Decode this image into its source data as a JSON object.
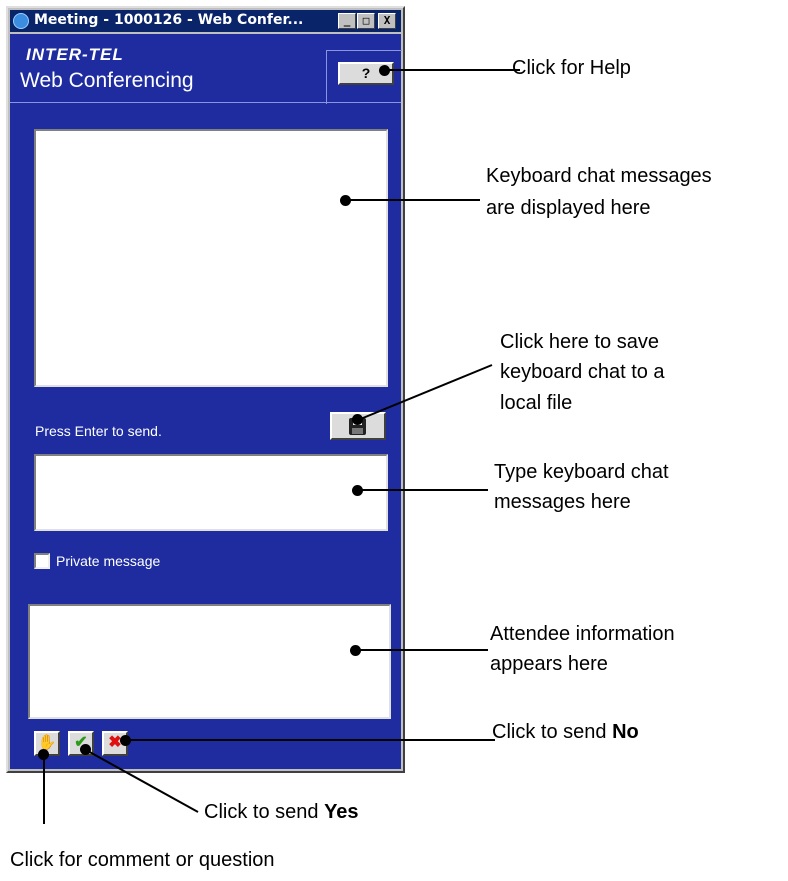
{
  "window": {
    "title": "Meeting - 1000126 - Web Confer...",
    "controls": [
      "_",
      "□",
      "X"
    ]
  },
  "header": {
    "logo": "INTER-TEL",
    "app_title": "Web Conferencing",
    "help_label": "?"
  },
  "chat": {
    "messages": "",
    "hint": "Press Enter to send.",
    "input_value": "",
    "private_label": "Private message",
    "private_checked": false
  },
  "attendee": {
    "info": ""
  },
  "buttons": {
    "hand_icon": "hand-icon",
    "yes_icon": "check-icon",
    "no_icon": "x-icon",
    "save_icon": "floppy-disk-icon",
    "yes_glyph": "✔",
    "no_glyph": "✖",
    "hand_glyph": "✋"
  },
  "callouts": {
    "help": "Click for Help",
    "messages_1": "Keyboard chat messages",
    "messages_2": "are displayed here",
    "save_1": "Click here to save",
    "save_2": "keyboard chat to a",
    "save_3": "local file",
    "type_1": "Type keyboard chat",
    "type_2": "messages here",
    "attendee_1": "Attendee information",
    "attendee_2": "appears here",
    "no_prefix": "Click to send ",
    "no_bold": "No",
    "yes_prefix": "Click to send ",
    "yes_bold": "Yes",
    "comment": "Click for comment or question"
  },
  "colors": {
    "window_bg": "#1e2ca0",
    "titlebar": "#0a246a",
    "yes": "#2e9a1a",
    "no": "#e01010"
  }
}
